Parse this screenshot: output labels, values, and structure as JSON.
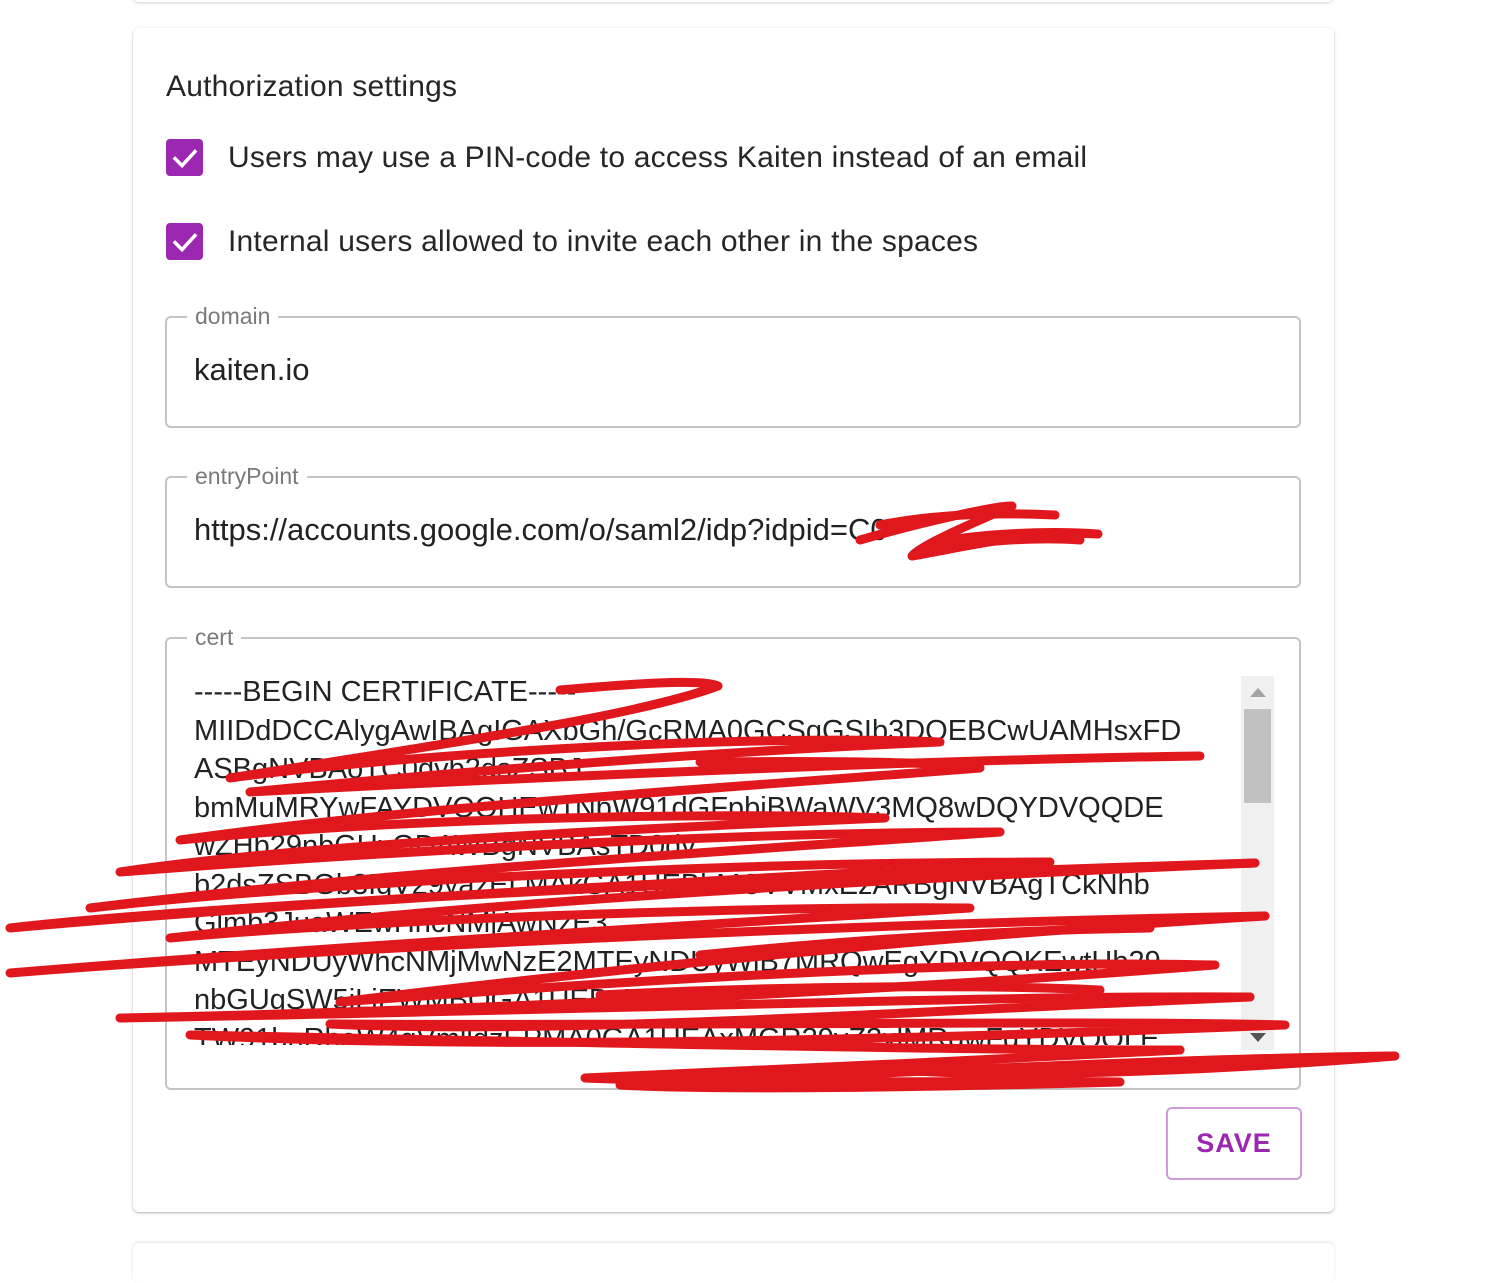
{
  "auth_settings": {
    "title": "Authorization settings",
    "options": [
      {
        "label": "Users may use a PIN-code to access Kaiten instead of an email",
        "checked": true
      },
      {
        "label": "Internal users allowed to invite each other in the spaces",
        "checked": true
      }
    ],
    "domain": {
      "label": "domain",
      "value": "kaiten.io"
    },
    "entry_point": {
      "label": "entryPoint",
      "value": "https://accounts.google.com/o/saml2/idp?idpid=C0"
    },
    "cert": {
      "label": "cert",
      "value": "-----BEGIN CERTIFICATE-----\nMIIDdDCCAlygAwIBAgIGAXbGh/GcRMA0GCSqGSIb3DQEBCwUAMHsxFD\nASBgNVBAoTC0dvb2dsZSBJ\nbmMuMRYwFAYDVQQHEw1NbW91dGFpbiBWaWV3MQ8wDQYDVQQDE\nwZHb29nbGUxGDAWBgNVBAsTD0dv\nb2dsZSBGb3IgV29yazELMAkGA1UEBhMCVVMxEzARBgNVBAgTCkNhb\nGlmb3JuaWEwHhcNMjAwNzE3\nMTEyNDUyWhcNMjMwNzE2MTEyNDUyWjB7MRQwEgYDVQQKEwtHb29\nnbGUgSW5jLjEWMBQGA1UEBxMN\nTW91bnRhaW4gVmlldzEPMA0GA1UEAxMGR29vZ2xlMRgwFgYDVQQLE"
    },
    "save_label": "SAVE"
  },
  "colors": {
    "accent": "#9c27b0",
    "scribble": "#e0181d"
  },
  "icons": {
    "checkbox": "check-icon",
    "scroll_up": "arrow-up-icon",
    "scroll_down": "arrow-down-icon"
  }
}
